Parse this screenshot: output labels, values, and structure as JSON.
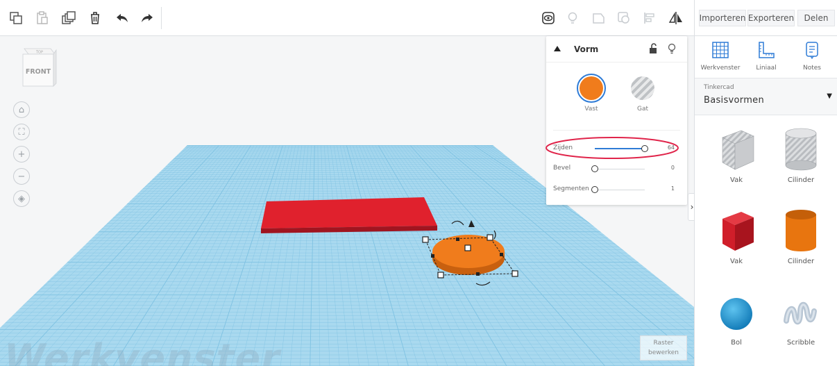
{
  "toolbar": {
    "icons": [
      "copy-icon",
      "paste-icon",
      "duplicate-icon",
      "trash-icon",
      "undo-icon",
      "redo-icon",
      "visibility-icon",
      "light-icon",
      "shape-tool-icon",
      "group-icon",
      "align-icon",
      "mirror-icon"
    ]
  },
  "header": {
    "import_label": "Importeren",
    "export_label": "Exporteren",
    "share_label": "Delen"
  },
  "tools": [
    {
      "label": "Werkvenster",
      "icon": "workplane-grid-icon"
    },
    {
      "label": "Liniaal",
      "icon": "ruler-icon"
    },
    {
      "label": "Notes",
      "icon": "notes-icon"
    }
  ],
  "library": {
    "category": "Tinkercad",
    "selected": "Basisvormen"
  },
  "shapes": [
    {
      "label": "Vak",
      "kind": "box-hole"
    },
    {
      "label": "Cilinder",
      "kind": "cylinder-hole"
    },
    {
      "label": "Vak",
      "kind": "box-red"
    },
    {
      "label": "Cilinder",
      "kind": "cylinder-orange"
    },
    {
      "label": "Bol",
      "kind": "sphere-blue"
    },
    {
      "label": "Scribble",
      "kind": "scribble"
    }
  ],
  "viewcube": {
    "top": "TOP",
    "front": "FRONT"
  },
  "inspector": {
    "title": "Vorm",
    "solid_label": "Vast",
    "hole_label": "Gat",
    "solid_color": "#f07c1c",
    "properties": [
      {
        "label": "Zijden",
        "value": "64",
        "fraction": 1.0
      },
      {
        "label": "Bevel",
        "value": "0",
        "fraction": 0.0
      },
      {
        "label": "Segmenten",
        "value": "1",
        "fraction": 0.0
      }
    ]
  },
  "workplane": {
    "watermark": "Werkvenster"
  },
  "grid_edit": {
    "line1": "Raster",
    "line2": "bewerken"
  },
  "colors": {
    "grid": "#a9d9ef",
    "grid_line": "#7fc2e2",
    "red_box": "#e0212d",
    "orange_shape": "#f07c1c",
    "accent_blue": "#2e7bd6",
    "highlight_ring": "#e0244a"
  }
}
